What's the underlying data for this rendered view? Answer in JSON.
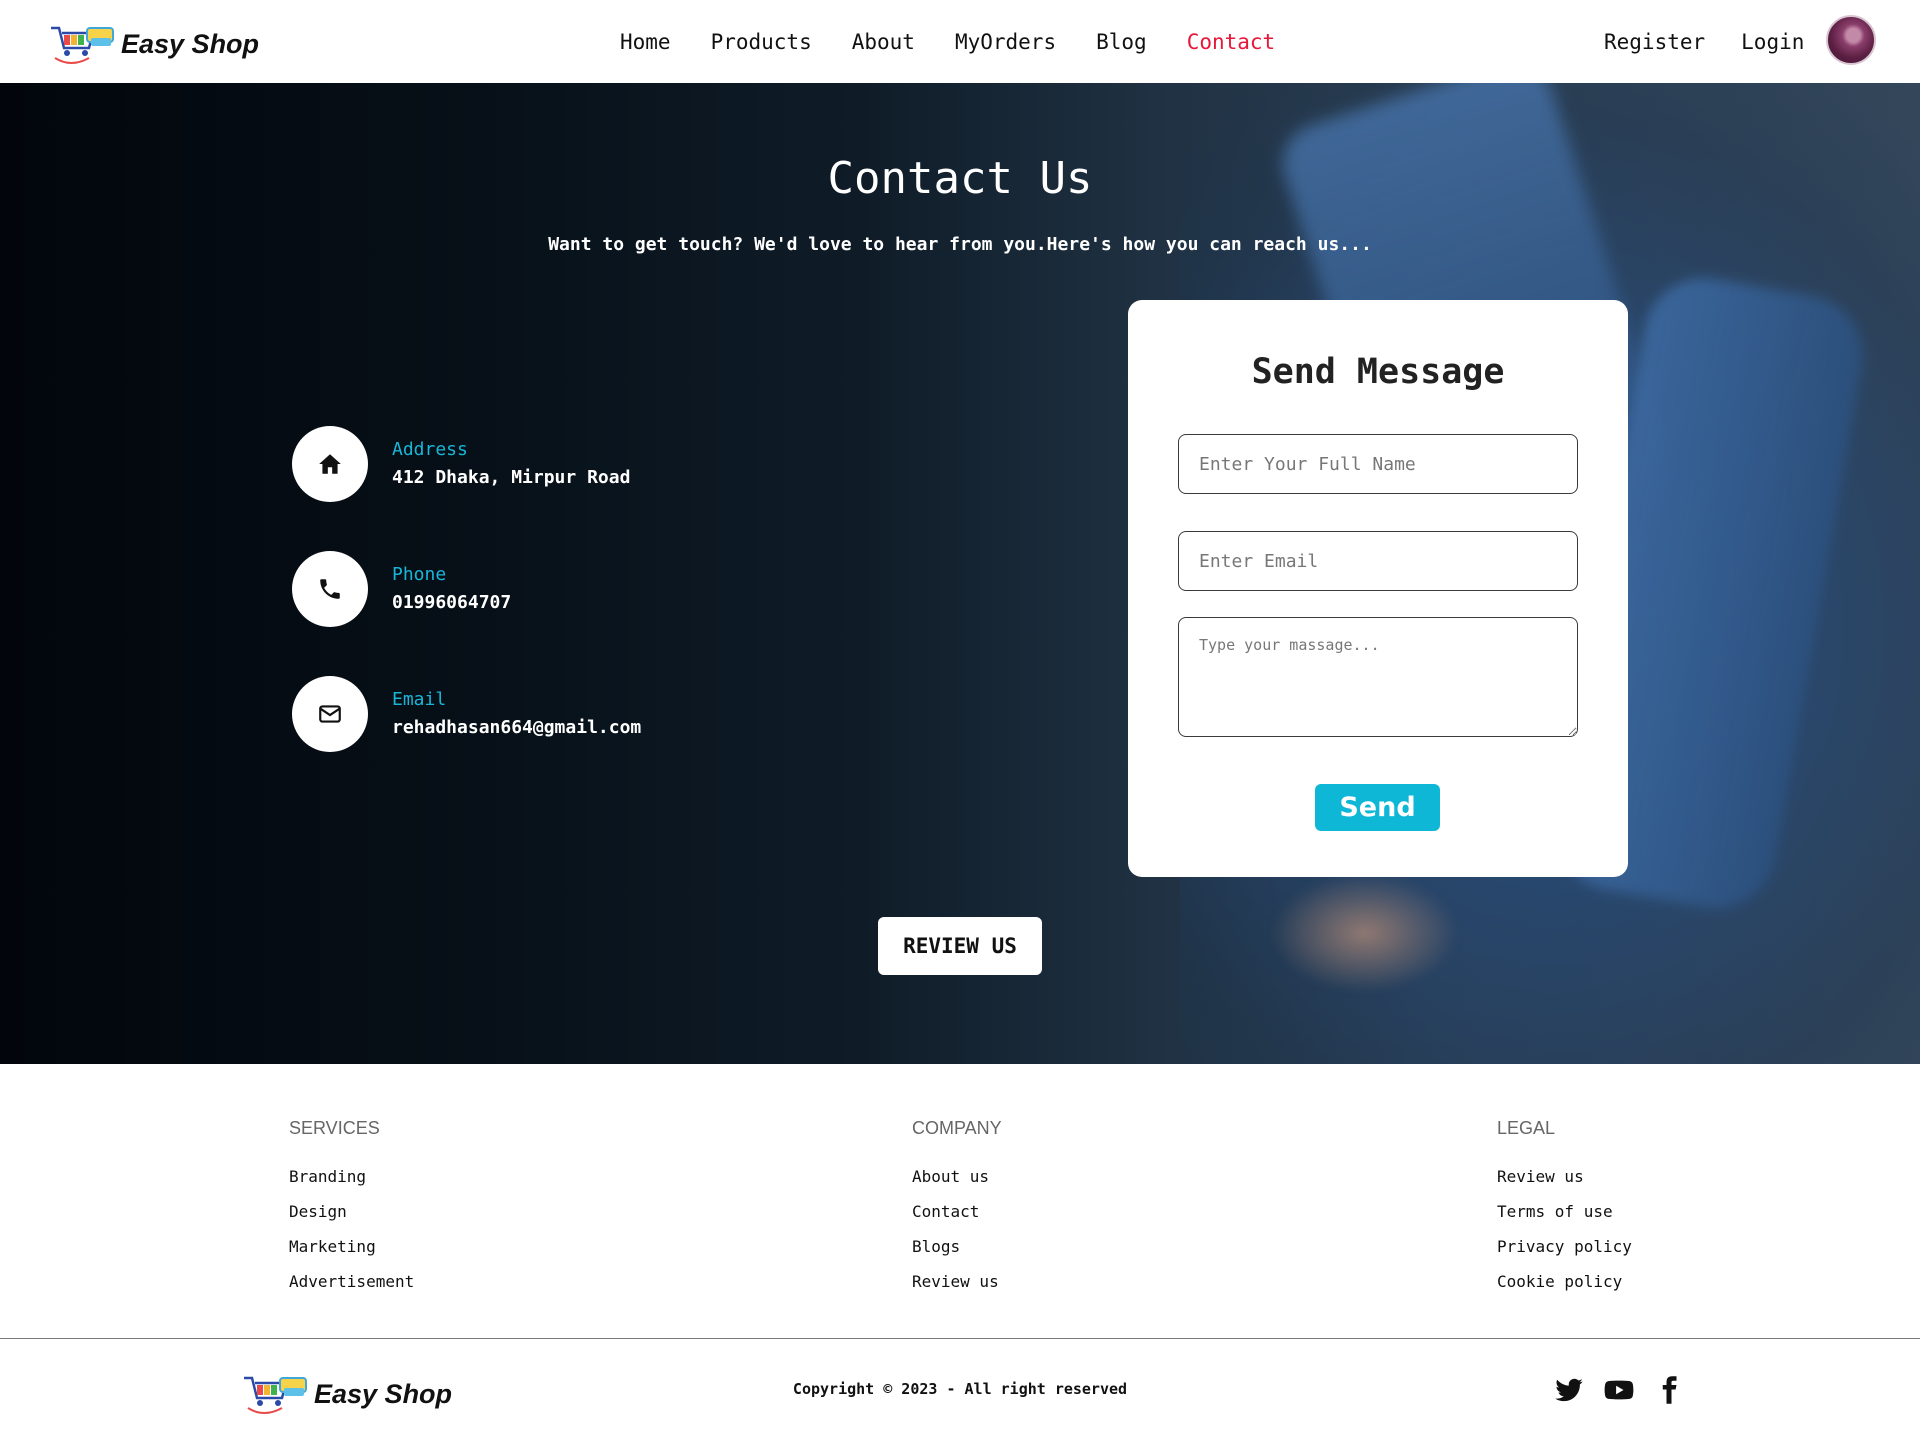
{
  "brand": {
    "name": "Easy Shop",
    "logo_icon": "shopping-cart-logo"
  },
  "nav": {
    "links": [
      "Home",
      "Products",
      "About",
      "MyOrders",
      "Blog",
      "Contact"
    ],
    "active": "Contact",
    "register": "Register",
    "login": "Login"
  },
  "hero": {
    "title": "Contact Us",
    "subtitle": "Want to get touch? We'd love to hear from you.Here's how you can reach us..."
  },
  "contact_info": [
    {
      "icon": "home-icon",
      "label": "Address",
      "value": "412 Dhaka, Mirpur Road"
    },
    {
      "icon": "phone-icon",
      "label": "Phone",
      "value": "01996064707"
    },
    {
      "icon": "mail-icon",
      "label": "Email",
      "value": "rehadhasan664@gmail.com"
    }
  ],
  "form": {
    "title": "Send Message",
    "name_placeholder": "Enter Your Full Name",
    "email_placeholder": "Enter Email",
    "message_placeholder": "Type your massage...",
    "send_label": "Send"
  },
  "review_button": "REVIEW US",
  "footer": {
    "columns": [
      {
        "heading": "SERVICES",
        "links": [
          "Branding",
          "Design",
          "Marketing",
          "Advertisement"
        ]
      },
      {
        "heading": "COMPANY",
        "links": [
          "About us",
          "Contact",
          "Blogs",
          "Review us"
        ]
      },
      {
        "heading": "LEGAL",
        "links": [
          "Review us",
          "Terms of use",
          "Privacy policy",
          "Cookie policy"
        ]
      }
    ],
    "copyright": "Copyright © 2023 - All right reserved",
    "social": [
      "twitter-icon",
      "youtube-icon",
      "facebook-icon"
    ]
  },
  "colors": {
    "accent": "#0fb7d7",
    "active_nav": "#e8173a",
    "info_label": "#19b6d8"
  }
}
